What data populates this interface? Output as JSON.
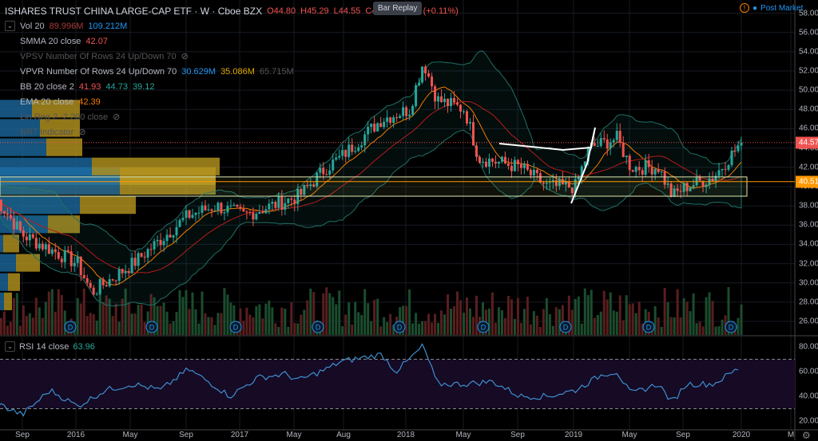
{
  "header": {
    "title": "ISHARES TRUST CHINA LARGE-CAP ETF · W · Cboe BZX",
    "open": "O44.80",
    "high": "H45.29",
    "low": "L44.55",
    "close": "C44.57",
    "change": "+0.05 (+0.11%)",
    "bar_replay": "Bar Replay",
    "post_market": "Post Market"
  },
  "indicators": [
    {
      "name": "Vol 20",
      "values": [
        "89.996M",
        "109.212M"
      ],
      "hidden": false
    },
    {
      "name": "SMMA 20 close",
      "values": [
        "42.07"
      ],
      "hidden": false
    },
    {
      "name": "VPSV Number Of Rows 24 Up/Down 70",
      "values": [],
      "hidden": true
    },
    {
      "name": "VPVR Number Of Rows 24 Up/Down 70",
      "values": [
        "30.629M",
        "35.086M",
        "65.715M"
      ],
      "hidden": false
    },
    {
      "name": "BB 20 close 2",
      "values": [
        "41.93",
        "44.73",
        "39.12"
      ],
      "hidden": false
    },
    {
      "name": "EMA 20 close",
      "values": [
        "42.39"
      ],
      "hidden": false
    },
    {
      "name": "Lin Reg 2 -2 200 close",
      "values": [],
      "hidden": true
    },
    {
      "name": "NR7 Indicator",
      "values": [],
      "hidden": true
    }
  ],
  "price_axis": [
    "58.00",
    "56.00",
    "54.00",
    "52.00",
    "50.00",
    "48.00",
    "46.00",
    "44.00",
    "42.00",
    "40.00",
    "38.00",
    "36.00",
    "34.00",
    "32.00",
    "30.00",
    "28.00",
    "26.00"
  ],
  "price_tags": {
    "last": "44.57",
    "level": "40.51"
  },
  "rsi": {
    "label": "RSI 14 close",
    "value": "63.96",
    "axis": [
      "80.00",
      "60.00",
      "40.00",
      "20.00"
    ]
  },
  "time_axis": [
    "Sep",
    "2016",
    "May",
    "Sep",
    "2017",
    "May",
    "Aug",
    "2018",
    "May",
    "Sep",
    "2019",
    "May",
    "Sep",
    "2020",
    "M"
  ],
  "dividend_marker": "D",
  "colors": {
    "up": "#26a69a",
    "down": "#ef5350",
    "last": "#ef5350",
    "level": "#ff9800",
    "rsi": "#2962ff"
  },
  "chart_data": {
    "type": "candlestick",
    "ylim": [
      26,
      58
    ],
    "price_path": [
      [
        "2015-07",
        39
      ],
      [
        "2015-09",
        35
      ],
      [
        "2016-01",
        32
      ],
      [
        "2016-02",
        29
      ],
      [
        "2016-05",
        32
      ],
      [
        "2016-09",
        37
      ],
      [
        "2016-11",
        38
      ],
      [
        "2017-01",
        37
      ],
      [
        "2017-05",
        39
      ],
      [
        "2017-07",
        42
      ],
      [
        "2017-08",
        43
      ],
      [
        "2017-11",
        47
      ],
      [
        "2018-01",
        48
      ],
      [
        "2018-02",
        53
      ],
      [
        "2018-03",
        49
      ],
      [
        "2018-05",
        48
      ],
      [
        "2018-06",
        43
      ],
      [
        "2018-09",
        42
      ],
      [
        "2018-11",
        40
      ],
      [
        "2019-01",
        40
      ],
      [
        "2019-02",
        44
      ],
      [
        "2019-04",
        45
      ],
      [
        "2019-05",
        42
      ],
      [
        "2019-07",
        42
      ],
      [
        "2019-08",
        39
      ],
      [
        "2019-09",
        40
      ],
      [
        "2019-11",
        41
      ],
      [
        "2020-01",
        44.57
      ]
    ],
    "rsi_path": [
      [
        "2015-07",
        35
      ],
      [
        "2015-09",
        25
      ],
      [
        "2015-11",
        45
      ],
      [
        "2016-01",
        32
      ],
      [
        "2016-03",
        45
      ],
      [
        "2016-05",
        50
      ],
      [
        "2016-07",
        45
      ],
      [
        "2016-09",
        62
      ],
      [
        "2016-11",
        48
      ],
      [
        "2016-12",
        40
      ],
      [
        "2017-02",
        55
      ],
      [
        "2017-04",
        58
      ],
      [
        "2017-05",
        53
      ],
      [
        "2017-07",
        62
      ],
      [
        "2017-08",
        68
      ],
      [
        "2017-11",
        74
      ],
      [
        "2017-12",
        60
      ],
      [
        "2018-01",
        70
      ],
      [
        "2018-02",
        81
      ],
      [
        "2018-03",
        50
      ],
      [
        "2018-05",
        50
      ],
      [
        "2018-07",
        52
      ],
      [
        "2018-09",
        40
      ],
      [
        "2018-11",
        40
      ],
      [
        "2019-01",
        45
      ],
      [
        "2019-03",
        58
      ],
      [
        "2019-04",
        60
      ],
      [
        "2019-05",
        42
      ],
      [
        "2019-07",
        50
      ],
      [
        "2019-08",
        35
      ],
      [
        "2019-09",
        50
      ],
      [
        "2019-11",
        50
      ],
      [
        "2020-01",
        64
      ]
    ],
    "rsi_bands": [
      30,
      70
    ]
  }
}
